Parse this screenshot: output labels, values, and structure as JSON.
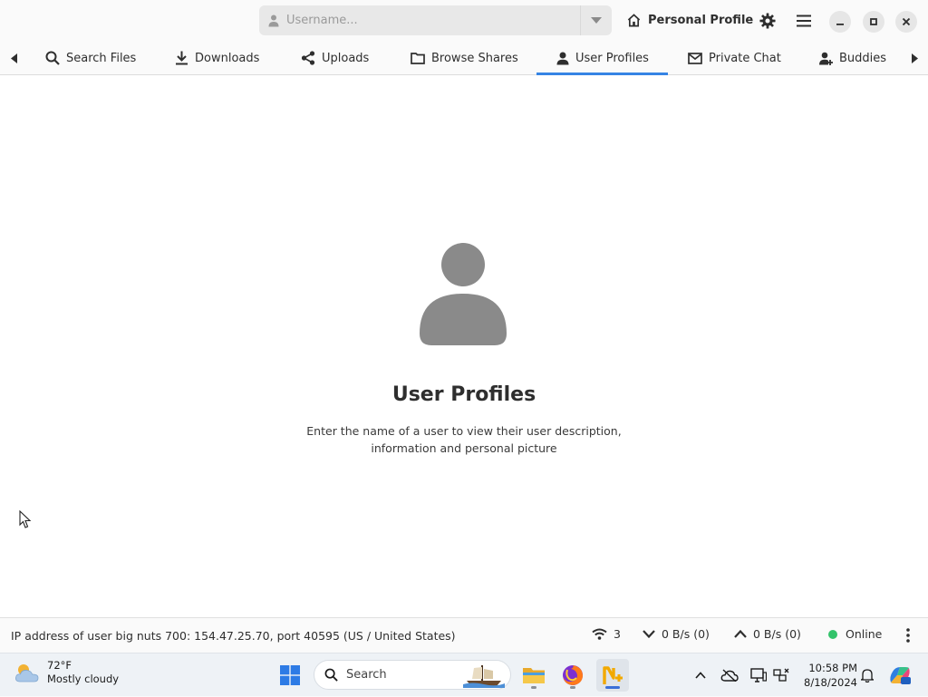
{
  "header": {
    "username_placeholder": "Username...",
    "personal_profile_label": "Personal Profile",
    "icons": [
      "user-icon",
      "dropdown-arrow-icon",
      "home-icon",
      "gear-icon",
      "hamburger-menu-icon",
      "minimize-icon",
      "maximize-icon",
      "close-icon"
    ]
  },
  "tabs": [
    {
      "label": "Search Files",
      "icon": "search-icon",
      "active": false
    },
    {
      "label": "Downloads",
      "icon": "download-icon",
      "active": false
    },
    {
      "label": "Uploads",
      "icon": "share-icon",
      "active": false
    },
    {
      "label": "Browse Shares",
      "icon": "folder-icon",
      "active": false
    },
    {
      "label": "User Profiles",
      "icon": "user-icon",
      "active": true
    },
    {
      "label": "Private Chat",
      "icon": "mail-icon",
      "active": false
    },
    {
      "label": "Buddies",
      "icon": "user-add-icon",
      "active": false
    }
  ],
  "main": {
    "title": "User Profiles",
    "description_line1": "Enter the name of a user to view their user description,",
    "description_line2": "information and personal picture"
  },
  "statusbar": {
    "message": "IP address of user big nuts 700: 154.47.25.70, port 40595 (US / United States)",
    "connections": "3",
    "download_speed": "0 B/s (0)",
    "upload_speed": "0 B/s (0)",
    "status": "Online"
  },
  "taskbar": {
    "weather_temp": "72°F",
    "weather_desc": "Mostly cloudy",
    "search_label": "Search",
    "time": "10:58 PM",
    "date": "8/18/2024"
  },
  "colors": {
    "accent": "#3584e4",
    "online": "#33c36b",
    "placeholder_icon": "#8a8a8a"
  }
}
